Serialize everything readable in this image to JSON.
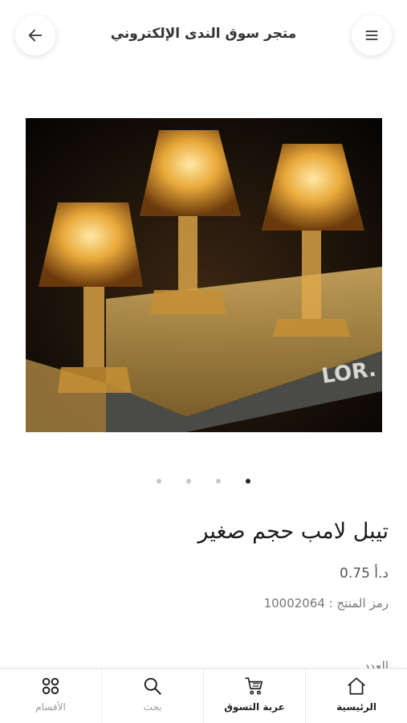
{
  "header": {
    "title": "متجر سوق الندى الإلكتروني",
    "back_icon": "arrow-left-icon",
    "menu_icon": "hamburger-menu-icon"
  },
  "gallery": {
    "image_alt": "تيبل لامب حجم صغير",
    "dot_count": 4,
    "active_dot": 4
  },
  "product": {
    "name": "تيبل لامب حجم صغير",
    "price": "0.75 د.أ",
    "sku_label": "رمز المنتج : 10002064",
    "quantity_label": "العدد"
  },
  "bottom_nav": {
    "items": [
      {
        "label": "الأقسام",
        "icon": "categories-grid-icon"
      },
      {
        "label": "بحث",
        "icon": "search-icon"
      },
      {
        "label": "عربة التسوق",
        "icon": "shopping-cart-icon"
      },
      {
        "label": "الرئيسية",
        "icon": "home-icon"
      }
    ]
  },
  "colors": {
    "accent_dark": "#222222",
    "muted": "#999999",
    "lamp_glow": "#f2b93b"
  }
}
